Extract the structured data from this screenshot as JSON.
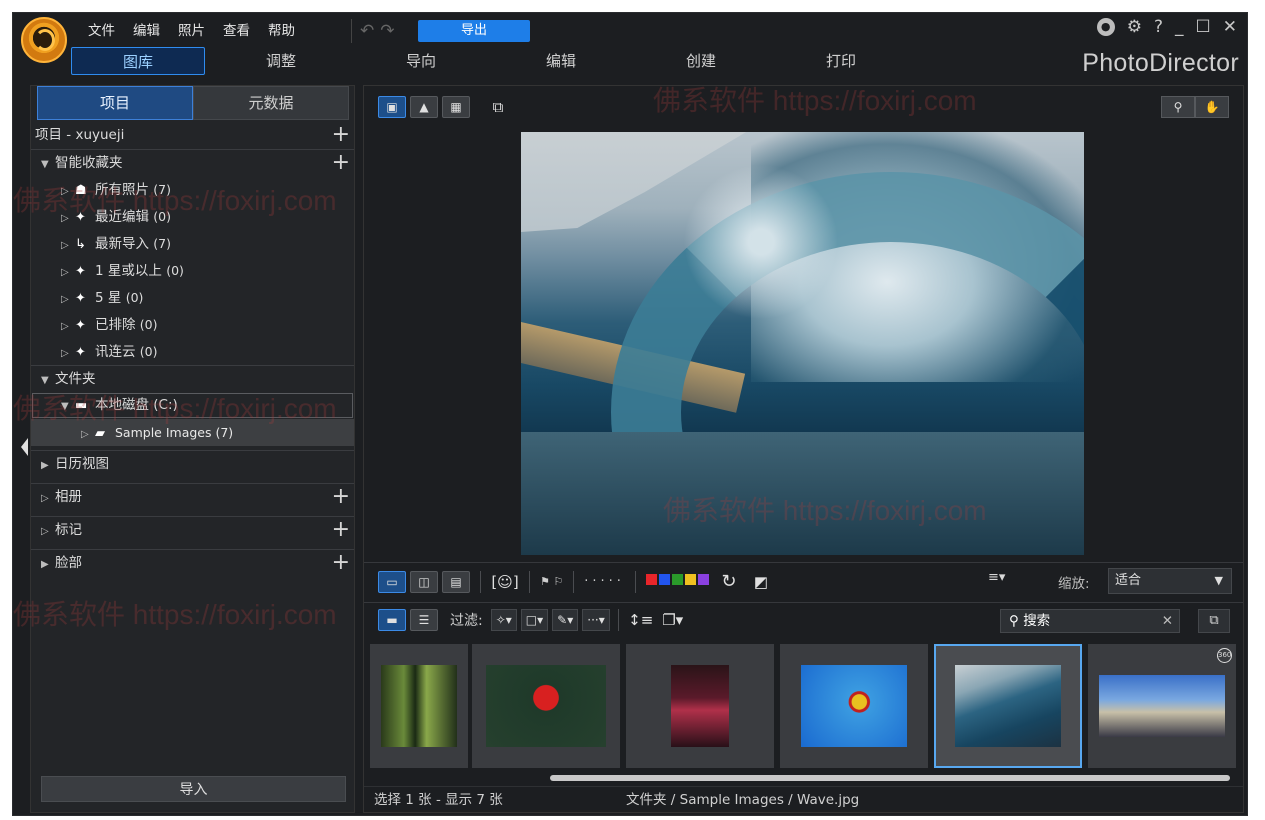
{
  "menu": [
    "文件",
    "编辑",
    "照片",
    "查看",
    "帮助"
  ],
  "export_label": "导出",
  "help_mark": "?",
  "mode_tabs": [
    "图库",
    "调整",
    "导向",
    "编辑",
    "创建",
    "打印"
  ],
  "brand": "PhotoDirector",
  "left_tabs": [
    "项目",
    "元数据"
  ],
  "tree": {
    "project": "项目 - xuyueji",
    "smart_collections": "智能收藏夹",
    "smart_items": [
      {
        "label": "所有照片",
        "count": "(7)"
      },
      {
        "label": "最近编辑",
        "count": "(0)"
      },
      {
        "label": "最新导入",
        "count": "(7)"
      },
      {
        "label": "1 星或以上",
        "count": "(0)"
      },
      {
        "label": "5 星",
        "count": "(0)"
      },
      {
        "label": "已排除",
        "count": "(0)"
      },
      {
        "label": "讯连云",
        "count": "(0)"
      }
    ],
    "folders": "文件夹",
    "disk": "本地磁盘 (C:)",
    "sample": "Sample Images (7)",
    "calendar": "日历视图",
    "albums": "相册",
    "tags": "标记",
    "faces": "脸部"
  },
  "import_label": "导入",
  "zoom": {
    "label": "缩放:",
    "value": "适合"
  },
  "filter_label": "过滤:",
  "search_value": "搜索",
  "color_labels": [
    "#e8252a",
    "#2255ee",
    "#2a9a2a",
    "#f0c020",
    "#8a40e0"
  ],
  "filmstrip_count": 6,
  "selected_thumb": 5,
  "badge_360": "360",
  "status": {
    "selection": "选择 1 张 - 显示 7 张",
    "path": "文件夹 / Sample Images / Wave.jpg"
  },
  "watermark": "佛系软件 https://foxirj.com"
}
